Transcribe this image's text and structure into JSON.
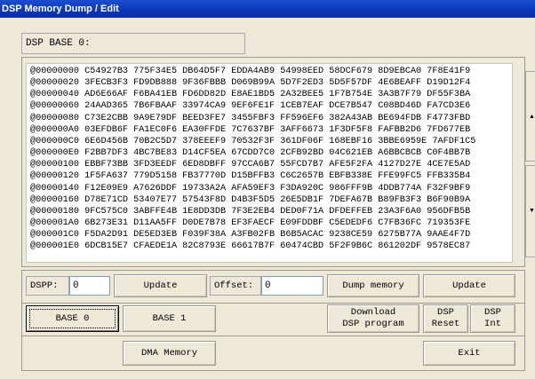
{
  "window": {
    "title": "DSP Memory Dump / Edit"
  },
  "base_label": "DSP BASE 0:",
  "dump_lines": [
    "@00000000 C54927B3 775F34E5 DB64D5F7 EDDA4AB9 54998EED 58DCF679 8D9EBCA0 7F8E41F9",
    "@00000020 3FECB3F3 FD9DB888 9F36FBBB D069B99A 5D7F2ED3 5D5F57DF 4E6BEAFF D19D12F4",
    "@00000040 AD6E66AF F6BA41EB FD6DD82D E8AE1BD5 2A32BEE5 1F7B754E 3A3B7F79 DF55F3BA",
    "@00000060 24AAD365 7B6FBAAF 33974CA9 9EF6FE1F 1CEB7EAF DCE7B547 C08BD46D FA7CD3E6",
    "@00000080 C73E2CBB 9A9E79DF BEED3FE7 3455FBF3 FF596EF6 382A43AB BE694FDB F4773FBD",
    "@000000A0 03EFDB6F FA1EC0F6 EA30FFDE 7C7637BF 3AFF6673 1F3DF5F8 FAFBB2D6 7FD677EB",
    "@000000C0 6E6D456B 70B2C5D7 378EEEF9 70532F3F 361DF06F 168EBF16 3BBE6959E 7AFDF1C5",
    "@000000E0 F2BB7DF3 4BC7BE83 D14CF5EA 67CDD7C0 2CFB92BD 04C621EB A6BBCBCB C0F4BB7B",
    "@00000100 EBBF73BB 3FD3EEDF 6ED8DBFF 97CCA6B7 55FCD7B7 AFE5F2FA 4127D27E 4CE7E5AD",
    "@00000120 1F5FA637 779D5158 FB37770D D15BFFB3 C6C2657B EBFB338E FFE99FC5 FFB335B4",
    "@00000140 F12E09E9 A7626DDF 19733A2A AFA59EF3 F3DA920C 986FFF9B 4DDB774A F32F9BF9",
    "@00000160 D78E71CD 53407E77 57543F8D D4B3F5D5 26E5DB1F 7DEFA67B B89FB3F3 B6F90B9A",
    "@00000180 9FC575C0 3ABFFE4B 1E8DD3DB 7F3E2EB4 DED0F71A DFDEFFEB 23A3F6A0 956DFB5B",
    "@000001A0 6B273E31 D11AA5FF D0DE7B78 EF3FAECF E09FDDBF C5EDEDF6 C7FB36FC 719353FE",
    "@000001C0 F5DA2D91 DE5ED3EB F039F38A A3FB02FB B6B5ACAC 9238CE59 6275B77A 9AAE4F7D",
    "@000001E0 6DCB15E7 CFAEDE1A 82C8793E 66617B7F 60474CBD 5F2F9B6C 861202DF 9578EC87"
  ],
  "dspp": {
    "label": "DSPP:",
    "value": "0"
  },
  "offset": {
    "label": "Offset:",
    "value": "0"
  },
  "buttons": {
    "update1": "Update",
    "dump_memory": "Dump memory",
    "update2": "Update",
    "base0": "BASE 0",
    "base1": "BASE 1",
    "download_line1": "Download",
    "download_line2": "DSP program",
    "dsp_reset_line1": "DSP",
    "dsp_reset_line2": "Reset",
    "dsp_int_line1": "DSP",
    "dsp_int_line2": "Int",
    "dma_memory": "DMA Memory",
    "exit": "Exit"
  },
  "colors": {
    "titlebar": "#0a37b8",
    "window_bg": "#ece9d8",
    "field_border": "#7f9db9"
  }
}
